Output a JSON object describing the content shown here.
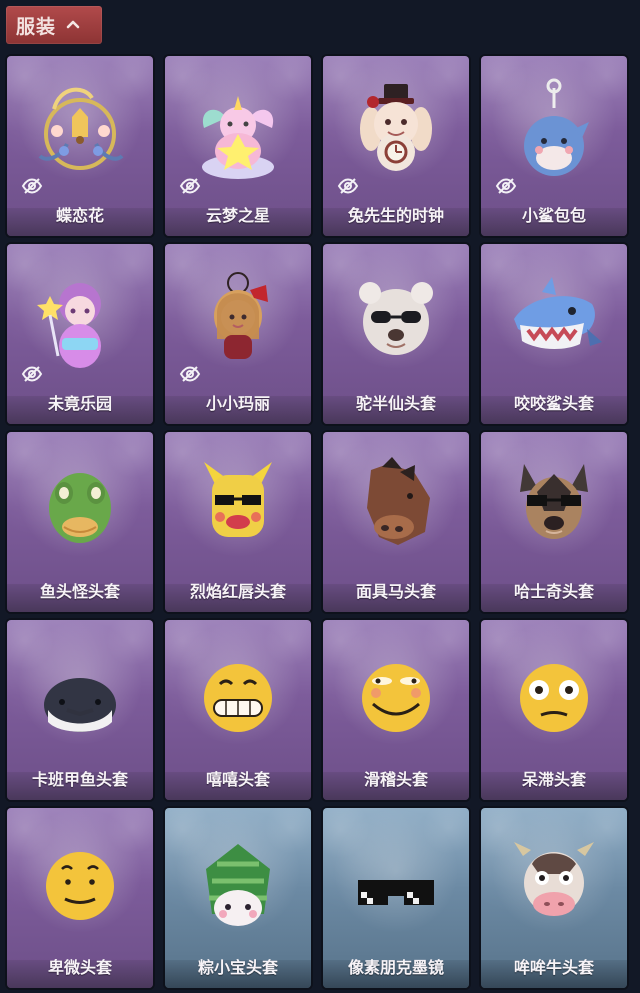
{
  "header": {
    "title": "服装",
    "toggle_icon": "chevron-up-icon",
    "accent": "#9c3b3d"
  },
  "items": [
    {
      "label": "蝶恋花",
      "hidden": true,
      "theme": "purple",
      "icon": "butterfly-flower-icon"
    },
    {
      "label": "云梦之星",
      "hidden": true,
      "theme": "purple",
      "icon": "unicorn-cloud-star-icon"
    },
    {
      "label": "兔先生的时钟",
      "hidden": true,
      "theme": "purple",
      "icon": "rabbit-clock-icon"
    },
    {
      "label": "小鲨包包",
      "hidden": true,
      "theme": "purple",
      "icon": "shark-bag-icon"
    },
    {
      "label": "未竟乐园",
      "hidden": true,
      "theme": "purple",
      "icon": "pink-doll-icon"
    },
    {
      "label": "小小玛丽",
      "hidden": true,
      "theme": "purple",
      "icon": "little-mary-icon"
    },
    {
      "label": "驼半仙头套",
      "hidden": false,
      "theme": "purple",
      "icon": "polar-bear-sunglasses-icon"
    },
    {
      "label": "咬咬鲨头套",
      "hidden": false,
      "theme": "purple",
      "icon": "shark-head-icon"
    },
    {
      "label": "鱼头怪头套",
      "hidden": false,
      "theme": "purple",
      "icon": "fish-head-icon"
    },
    {
      "label": "烈焰红唇头套",
      "hidden": false,
      "theme": "purple",
      "icon": "yellow-mascot-icon"
    },
    {
      "label": "面具马头套",
      "hidden": false,
      "theme": "purple",
      "icon": "horse-head-icon"
    },
    {
      "label": "哈士奇头套",
      "hidden": false,
      "theme": "purple",
      "icon": "dog-head-icon"
    },
    {
      "label": "卡班甲鱼头套",
      "hidden": false,
      "theme": "purple",
      "icon": "whale-head-icon"
    },
    {
      "label": "嘻嘻头套",
      "hidden": false,
      "theme": "purple",
      "icon": "grin-face-icon"
    },
    {
      "label": "滑稽头套",
      "hidden": false,
      "theme": "purple",
      "icon": "smirk-face-icon"
    },
    {
      "label": "呆滞头套",
      "hidden": false,
      "theme": "purple",
      "icon": "dazed-face-icon"
    },
    {
      "label": "卑微头套",
      "hidden": false,
      "theme": "purple",
      "icon": "sad-smile-face-icon"
    },
    {
      "label": "粽小宝头套",
      "hidden": false,
      "theme": "blue",
      "icon": "zongzi-head-icon"
    },
    {
      "label": "像素朋克墨镜",
      "hidden": false,
      "theme": "blue",
      "icon": "pixel-sunglasses-icon"
    },
    {
      "label": "哞哞牛头套",
      "hidden": false,
      "theme": "blue",
      "icon": "cow-head-icon"
    }
  ]
}
